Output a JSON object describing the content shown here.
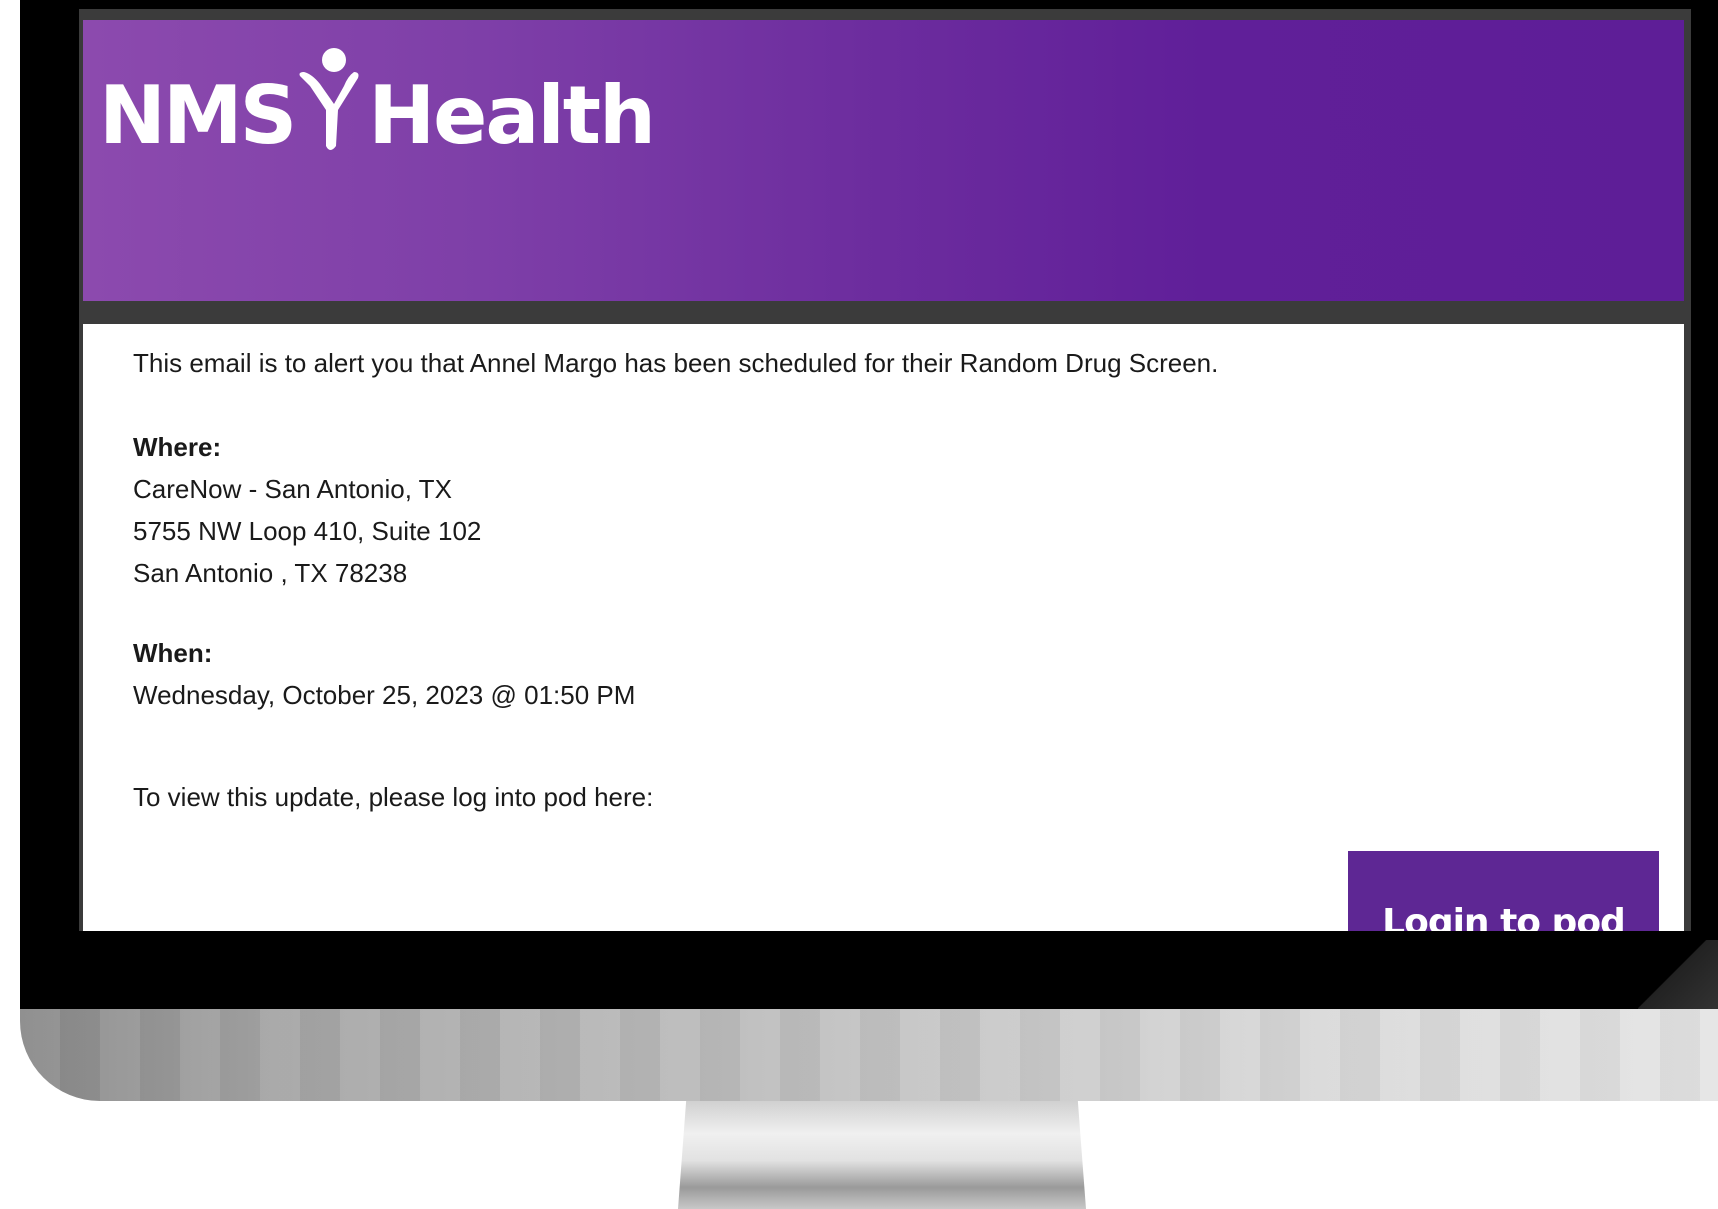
{
  "brand": {
    "logo_part1": "NMS",
    "logo_part2": "Health",
    "banner_color": "#6a2aa0"
  },
  "email": {
    "intro": "This email is to alert you that Annel Margo has been scheduled for their Random Drug Screen.",
    "where_label": "Where:",
    "where_lines": [
      "CareNow - San Antonio, TX",
      "5755 NW Loop 410, Suite 102",
      "San Antonio , TX 78238"
    ],
    "when_label": "When:",
    "when_value": "Wednesday, October 25, 2023 @ 01:50 PM",
    "view_text": "To view this update, please log into pod here:",
    "login_button": "Login to pod",
    "button_color": "#5e2794"
  }
}
